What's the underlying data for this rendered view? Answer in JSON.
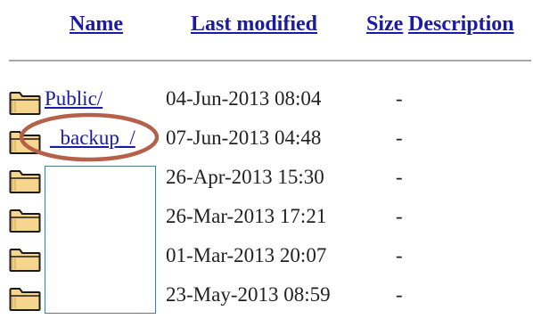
{
  "header": {
    "name": "Name",
    "last_modified": "Last modified",
    "size": "Size",
    "description": "Description"
  },
  "rows": [
    {
      "name": "Public/",
      "date": "04-Jun-2013 08:04",
      "size": "-"
    },
    {
      "name": "_backup_/",
      "date": "07-Jun-2013 04:48",
      "size": "-"
    },
    {
      "name": "",
      "date": "26-Apr-2013 15:30",
      "size": "-"
    },
    {
      "name": "",
      "date": "26-Mar-2013 17:21",
      "size": "-"
    },
    {
      "name": "",
      "date": "01-Mar-2013 20:07",
      "size": "-"
    },
    {
      "name": "",
      "date": "23-May-2013 08:59",
      "size": "-"
    }
  ],
  "colors": {
    "link": "#1a1aa8",
    "annotation": "#b56048",
    "redaction_border": "#4c7f88",
    "folder_fill": "#f6d58f",
    "folder_outline": "#1a1a1a"
  },
  "icons": {
    "folder": "folder-icon"
  }
}
